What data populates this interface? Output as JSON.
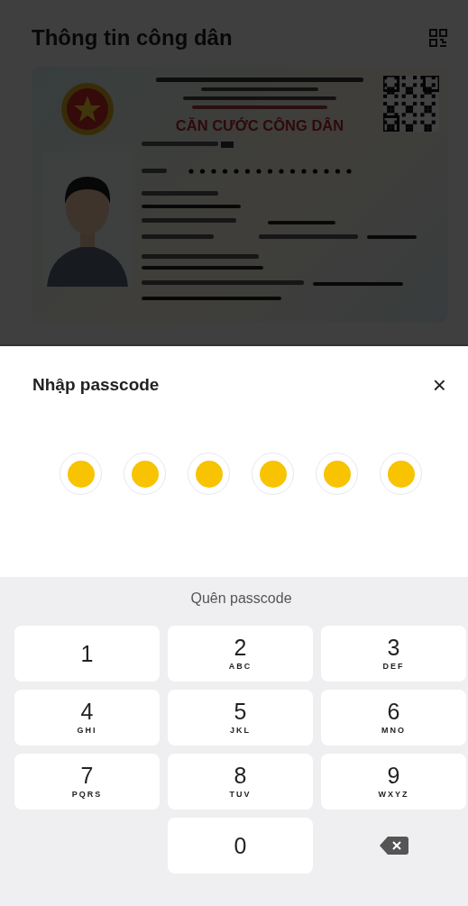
{
  "header": {
    "title": "Thông tin công dân"
  },
  "id_card": {
    "card_title": "CĂN CƯỚC CÔNG DÂN"
  },
  "sheet": {
    "title": "Nhập passcode",
    "close": "×",
    "passcode_dots": [
      {
        "filled": true
      },
      {
        "filled": true
      },
      {
        "filled": true
      },
      {
        "filled": true
      },
      {
        "filled": true
      },
      {
        "filled": true
      }
    ],
    "forgot_link": "Quên passcode"
  },
  "keypad": [
    {
      "kind": "digit",
      "digit": "1"
    },
    {
      "kind": "digit",
      "digit": "2",
      "letters": "ABC"
    },
    {
      "kind": "digit",
      "digit": "3",
      "letters": "DEF"
    },
    {
      "kind": "digit",
      "digit": "4",
      "letters": "GHI"
    },
    {
      "kind": "digit",
      "digit": "5",
      "letters": "JKL"
    },
    {
      "kind": "digit",
      "digit": "6",
      "letters": "MNO"
    },
    {
      "kind": "digit",
      "digit": "7",
      "letters": "PQRS"
    },
    {
      "kind": "digit",
      "digit": "8",
      "letters": "TUV"
    },
    {
      "kind": "digit",
      "digit": "9",
      "letters": "WXYZ"
    },
    {
      "kind": "blank"
    },
    {
      "kind": "digit",
      "digit": "0"
    },
    {
      "kind": "backspace"
    }
  ]
}
